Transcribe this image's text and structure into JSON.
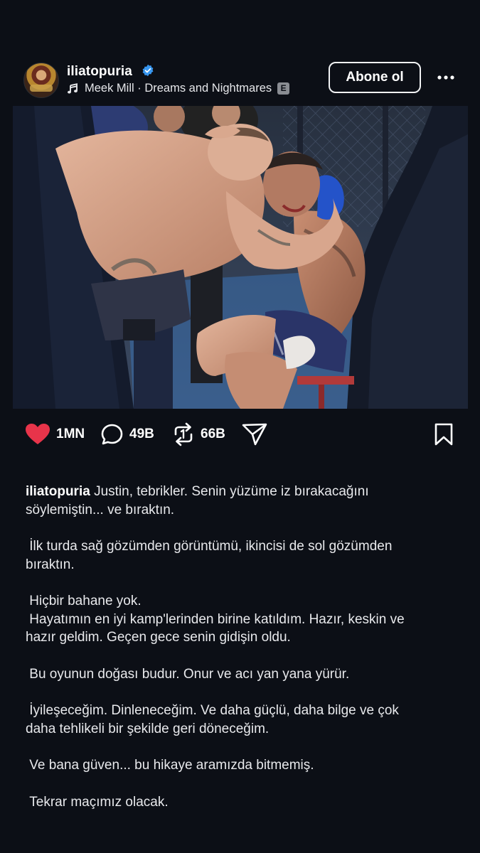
{
  "post": {
    "username": "iliatopuria",
    "music": "Meek Mill · Dreams and Nightmares",
    "explicit_badge": "E",
    "follow_label": "Abone ol"
  },
  "actions": {
    "likes": "1MN",
    "comments": "49B",
    "reposts": "66B"
  },
  "caption": {
    "p1": "Justin, tebrikler. Senin yüzüme iz bırakacağını\nsöylemiştin... ve bıraktın.",
    "p2": " İlk turda sağ gözümden görüntümü, ikincisi de sol gözümden\nbıraktın.",
    "p3": " Hiçbir bahane yok.\n Hayatımın en iyi kamp'lerinden birine katıldım. Hazır, keskin ve\nhazır geldim. Geçen gece senin gidişin oldu.",
    "p4": " Bu oyunun doğası budur. Onur ve acı yan yana yürür.",
    "p5": " İyileşeceğim. Dinleneceğim. Ve daha güçlü, daha bilge ve çok\ndaha tehlikeli bir şekilde geri döneceğim.",
    "p6": " Ve bana güven... bu hikaye aramızda bitmemiş.",
    "p7": " Tekrar maçımız olacak."
  },
  "colors": {
    "background": "#0c0f16",
    "like_red": "#e8344a",
    "verified_blue": "#3897f0"
  },
  "icons": [
    "verified-badge-icon",
    "music-note-icon",
    "more-icon",
    "heart-icon",
    "comment-icon",
    "repost-icon",
    "share-icon",
    "bookmark-icon",
    "mute-icon"
  ]
}
